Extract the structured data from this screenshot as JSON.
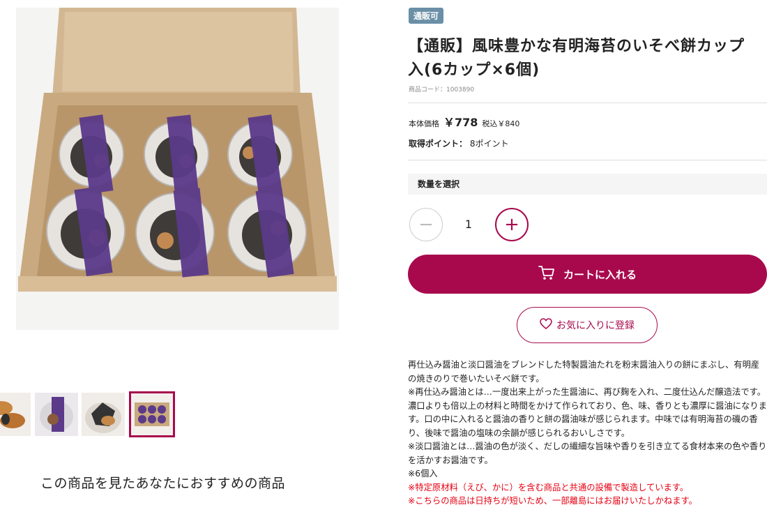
{
  "product": {
    "badge": "通販可",
    "title": "【通販】風味豊かな有明海苔のいそべ餅カップ入(6カップ×6個)",
    "code": "商品コード：1003890",
    "price_label": "本体価格",
    "price": "￥778",
    "price_tax": "税込￥840",
    "points_label": "取得ポイント：",
    "points_value": "8ポイント"
  },
  "quantity": {
    "header": "数量を選択",
    "value": "1",
    "minus": "−",
    "plus": "+"
  },
  "buttons": {
    "cart": "カートに入れる",
    "favorite": "お気に入りに登録"
  },
  "description": {
    "lines": [
      "再仕込み醤油と淡口醤油をブレンドした特製醤油たれを粉末醤油入りの餅にまぶし、有明産の焼きのりで巻いたいそべ餅です。",
      "※再仕込み醤油とは…一度出来上がった生醤油に、再び麹を入れ、二度仕込んだ醸造法です。濃口よりも倍以上の材料と時間をかけて作られており、色、味、香りとも濃厚に醤油になります。口の中に入れると醤油の香りと餅の醤油味が感じられます。中味では有明海苔の磯の香り、後味で醤油の塩味の余韻が感じられるおいしさです。",
      "※淡口醤油とは…醤油の色が淡く、だしの繊細な旨味や香りを引き立てる食材本来の色や香りを活かすお醤油です。",
      "※6個入"
    ],
    "notes": [
      "※特定原材料（えび、かに）を含む商品と共通の設備で製造しています。",
      "※こちらの商品は日持ちが短いため、一部離島にはお届けいたしかねます。"
    ]
  },
  "recommend": {
    "title": "この商品を見たあなたにおすすめの商品"
  },
  "gallery": {
    "main_image": "product-box-with-six-cups",
    "thumbnails": [
      "mochi-closeup",
      "cup-with-label",
      "mochi-in-cup",
      "box-top-view"
    ],
    "active_thumbnail": 3
  },
  "colors": {
    "accent": "#a8094d",
    "badge": "#6a8fa6",
    "warning": "#e60012",
    "label_purple": "#5b3a8a"
  }
}
